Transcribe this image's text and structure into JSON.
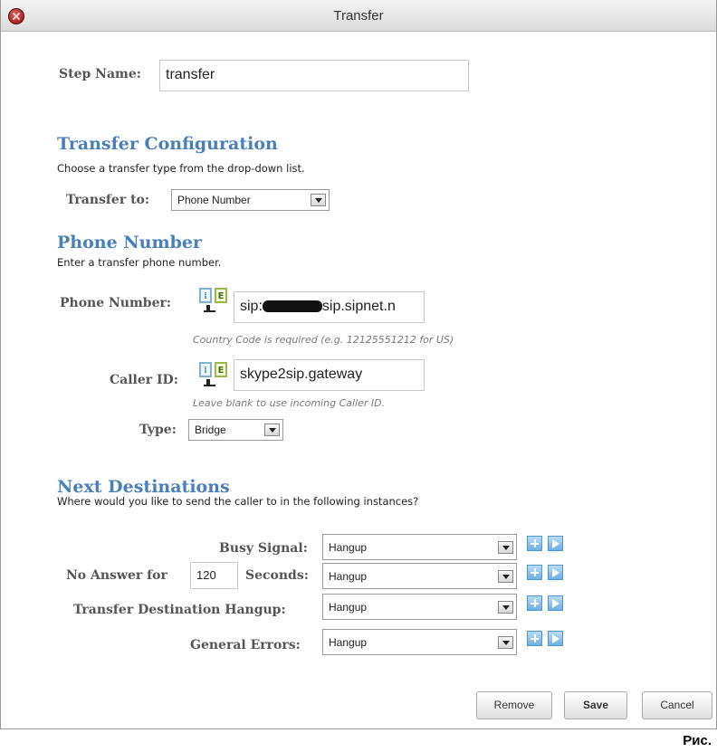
{
  "window": {
    "title": "Transfer"
  },
  "step": {
    "label": "Step Name:",
    "value": "transfer"
  },
  "transfer_config": {
    "heading": "Transfer Configuration",
    "description": "Choose a transfer type from the drop-down list.",
    "transfer_to_label": "Transfer to:",
    "transfer_to_value": "Phone Number"
  },
  "phone_number": {
    "heading": "Phone Number",
    "description": "Enter a transfer phone number.",
    "phone_label": "Phone Number:",
    "phone_prefix": "sip:",
    "phone_suffix": "sip.sipnet.n",
    "phone_hint": "Country Code is required (e.g. 12125551212 for US)",
    "caller_id_label": "Caller ID:",
    "caller_id_value": "skype2sip.gateway",
    "caller_id_hint": "Leave blank to use incoming Caller ID.",
    "type_label": "Type:",
    "type_value": "Bridge"
  },
  "next_destinations": {
    "heading": "Next Destinations",
    "description": "Where would you like to send the caller to in the following instances?",
    "busy_label": "Busy Signal:",
    "busy_value": "Hangup",
    "no_answer_prefix": "No Answer for",
    "no_answer_seconds": "120",
    "no_answer_suffix": "Seconds:",
    "no_answer_value": "Hangup",
    "hangup_label": "Transfer Destination Hangup:",
    "hangup_value": "Hangup",
    "errors_label": "General Errors:",
    "errors_value": "Hangup"
  },
  "buttons": {
    "remove": "Remove",
    "save": "Save",
    "cancel": "Cancel"
  },
  "caption": "Рис.",
  "colors": {
    "heading": "#4a7fb9",
    "label": "#555555",
    "accent_button": "#6fb0e3"
  }
}
